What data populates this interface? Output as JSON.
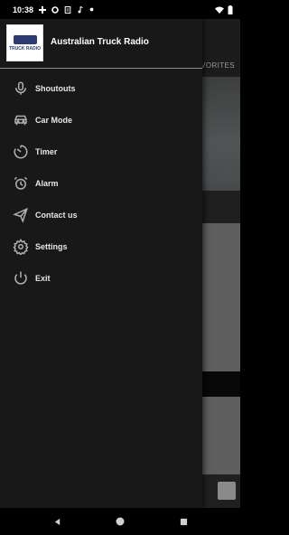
{
  "status_bar": {
    "time": "10:38",
    "left_icons": [
      "plus-cross-icon",
      "gear-icon",
      "clipboard-icon",
      "music-note-icon",
      "dot-icon"
    ],
    "right_icons": [
      "wifi-icon",
      "battery-icon"
    ]
  },
  "drawer": {
    "app_title": "Australian Truck Radio",
    "logo_text": "TRUCK RADIO",
    "menu": [
      {
        "label": "Shoutouts",
        "icon": "microphone-icon"
      },
      {
        "label": "Car Mode",
        "icon": "car-icon"
      },
      {
        "label": "Timer",
        "icon": "timer-icon"
      },
      {
        "label": "Alarm",
        "icon": "alarm-clock-icon"
      },
      {
        "label": "Contact us",
        "icon": "send-icon"
      },
      {
        "label": "Settings",
        "icon": "gear-icon"
      },
      {
        "label": "Exit",
        "icon": "power-icon"
      }
    ]
  },
  "background": {
    "tab_label": "AVORITES"
  },
  "nav_bar": {
    "buttons": [
      "back-icon",
      "home-icon",
      "recents-icon"
    ]
  },
  "colors": {
    "drawer_bg": "#181818",
    "icon_color": "#b0b0b0",
    "text_color": "#e6e6e6"
  }
}
